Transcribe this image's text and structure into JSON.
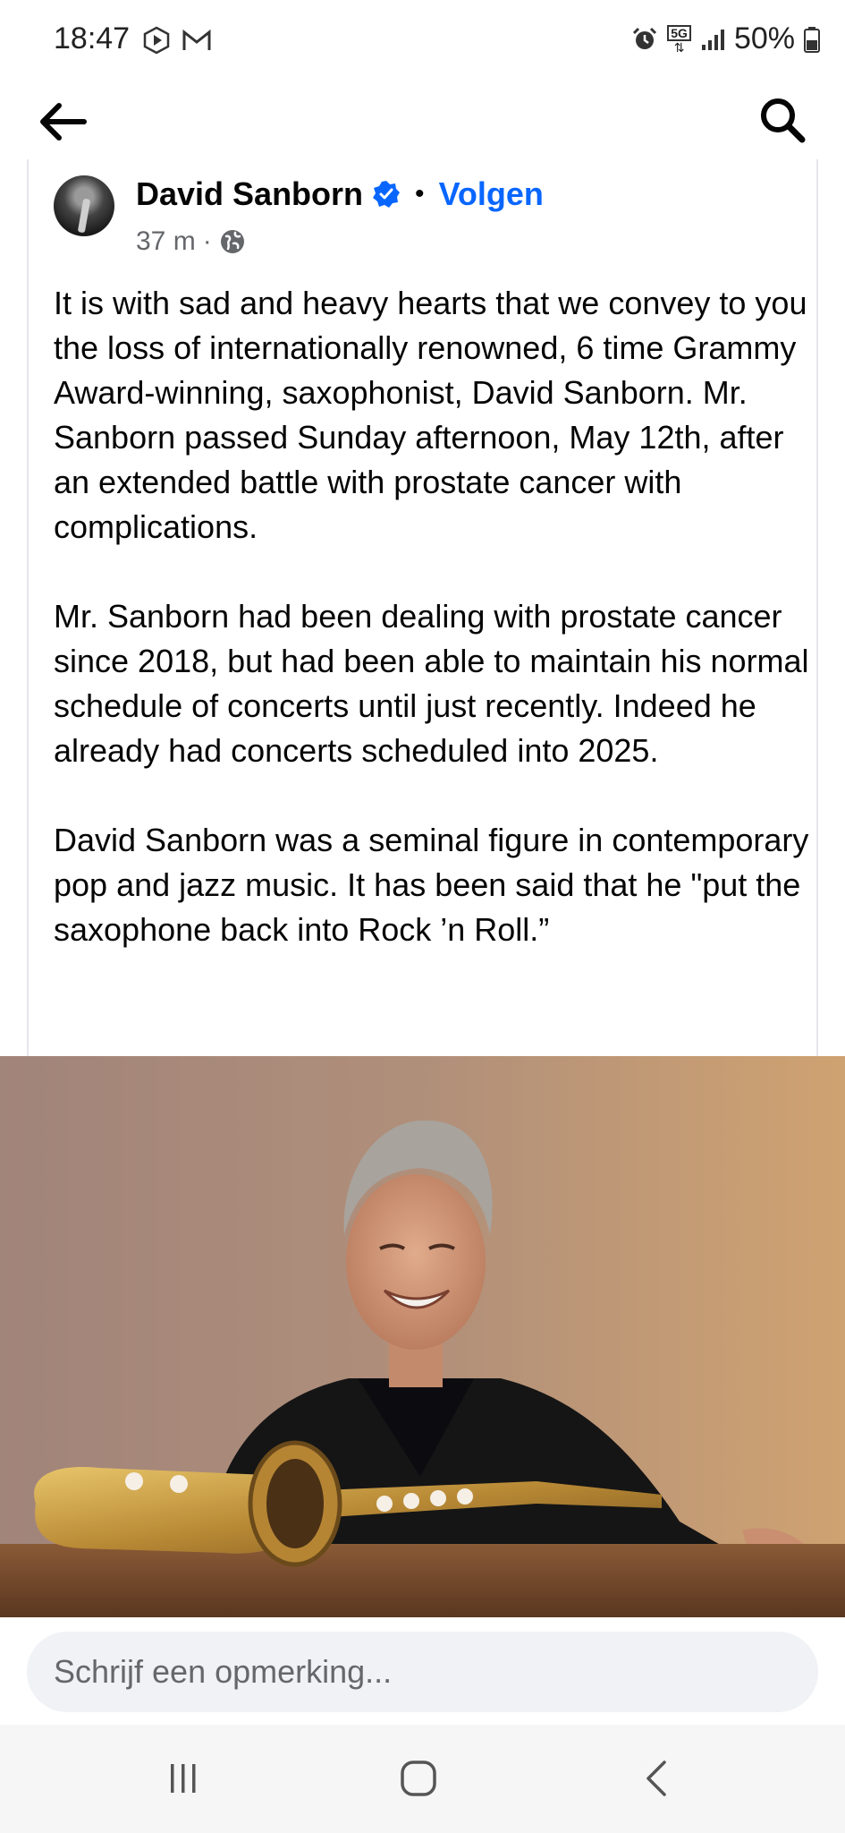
{
  "status_bar": {
    "time": "18:47",
    "battery": "50%",
    "network": "5G"
  },
  "header": {
    "back_icon": "arrow-left-icon",
    "search_icon": "search-icon"
  },
  "post": {
    "author": "David Sanborn",
    "verified": true,
    "separator": "•",
    "follow_label": "Volgen",
    "time_ago": "37 m",
    "meta_separator": "·",
    "audience_icon": "globe-icon",
    "paragraphs": [
      "It is with sad and heavy hearts that we convey to you the loss of internationally renowned, 6 time Grammy Award-winning, saxophonist, David Sanborn.  Mr. Sanborn passed Sunday afternoon, May 12th, after an extended battle with prostate cancer with complications.",
      "Mr. Sanborn had been dealing with prostate cancer since 2018, but had been able to maintain his normal schedule of concerts until just recently. Indeed he already had concerts scheduled into 2025.",
      "David Sanborn was a seminal figure in contemporary pop and jazz music. It has been said that he \"put the saxophone back into Rock ’n Roll.”"
    ]
  },
  "comment": {
    "placeholder": "Schrijf een opmerking..."
  },
  "colors": {
    "accent": "#0866ff",
    "muted": "#65676b",
    "input_bg": "#f0f2f5"
  }
}
